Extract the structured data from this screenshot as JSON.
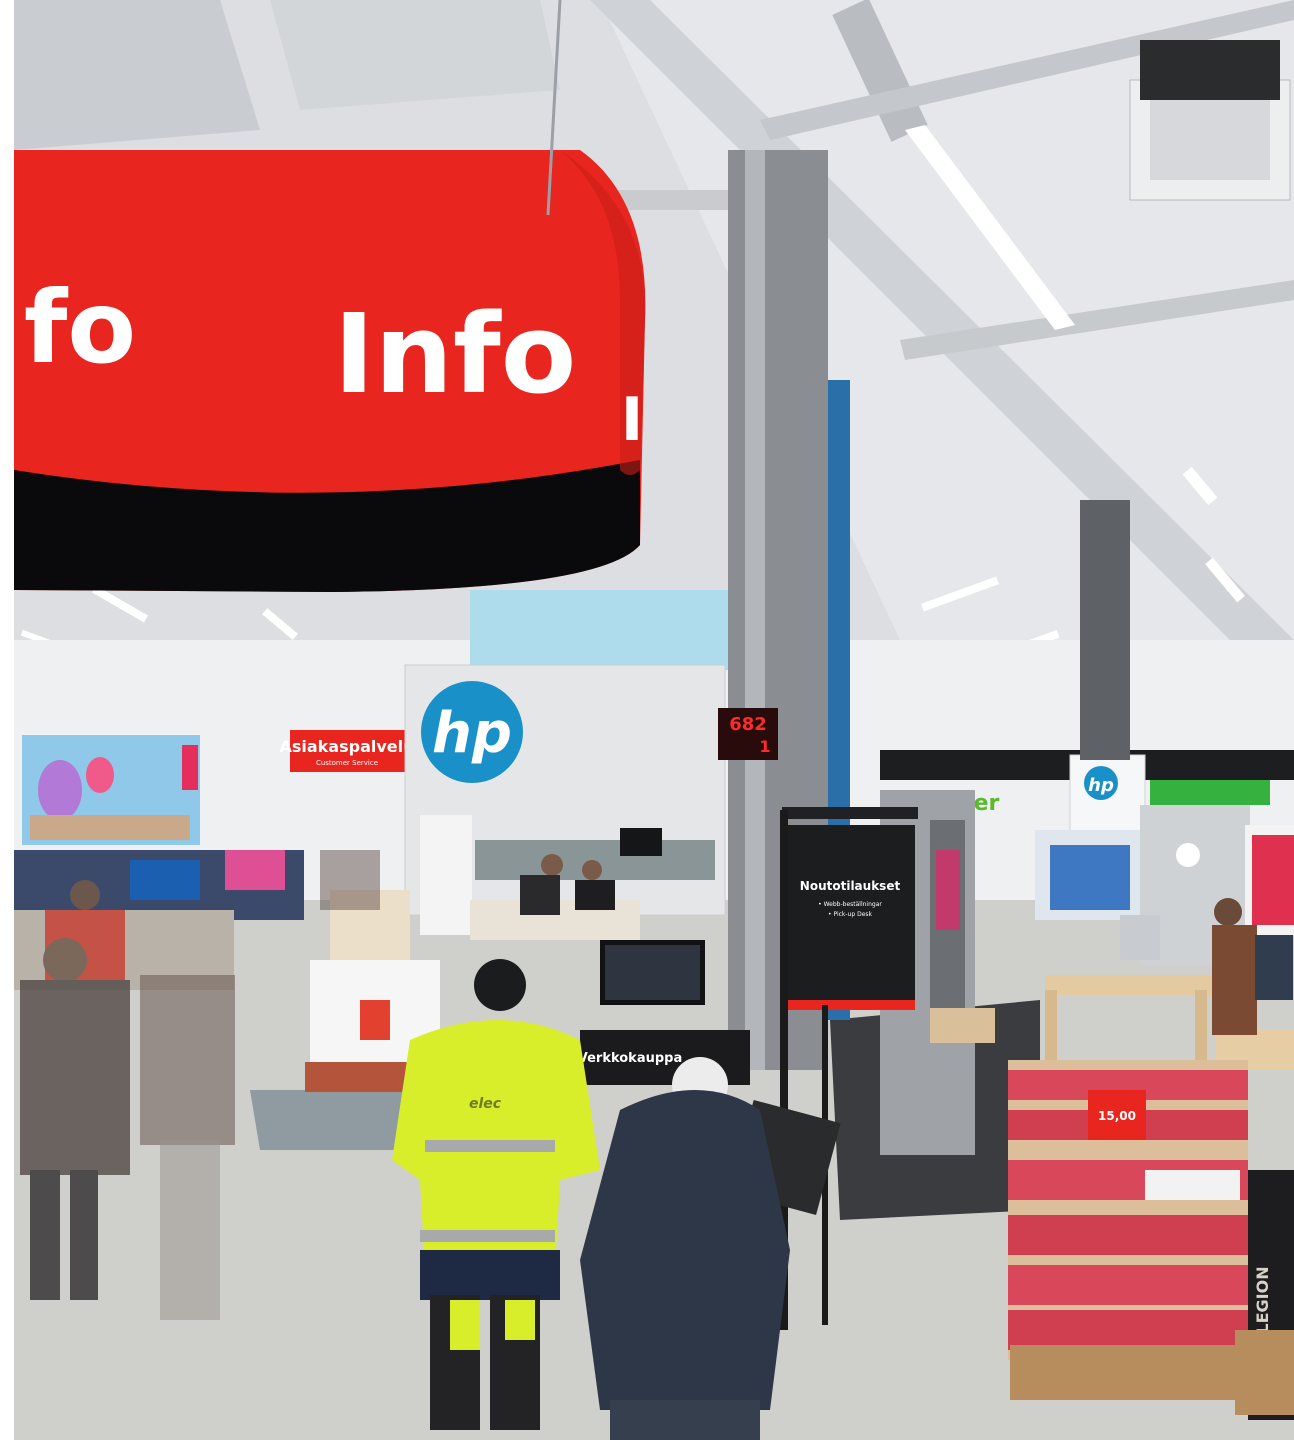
{
  "scene": {
    "info_sign_left": "fo",
    "info_sign_center": "Info",
    "info_sign_right": "I",
    "service_sign": "Asiakaspalvelu",
    "service_sign_sub": "Customer Service",
    "hp_logo": "hp",
    "hp_logo_small": "hp",
    "counter_top": "682",
    "counter_bottom": "1",
    "pickup_title": "Noutotilaukset",
    "pickup_line1": "• Webb-beställningar",
    "pickup_line2": "• Pick-up Desk",
    "jacket_logo": "elec",
    "price_tag": "15,00",
    "brand_left": "LEGION",
    "partial_brand": "cer",
    "verkkokauppa": "Verkkokauppa"
  },
  "colors": {
    "red": "#e8261f",
    "hp_blue": "#1a90c9",
    "hi_vis": "#d9ee2a",
    "ceiling": "#dfe1e4",
    "floor": "#cfcfcd"
  }
}
